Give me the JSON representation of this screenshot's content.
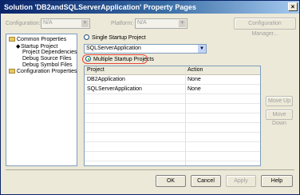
{
  "window": {
    "title": "Solution 'DB2andSQLServerApplication' Property Pages",
    "close_glyph": "×"
  },
  "topbar": {
    "configuration_label": "Configuration:",
    "configuration_value": "N/A",
    "platform_label": "Platform:",
    "platform_value": "N/A",
    "config_manager_label": "Configuration Manager..."
  },
  "tree": {
    "common_properties": "Common Properties",
    "startup_project": "Startup Project",
    "project_dependencies": "Project Dependencies",
    "debug_source_files": "Debug Source Files",
    "debug_symbol_files": "Debug Symbol Files",
    "configuration_properties": "Configuration Properties"
  },
  "content": {
    "single_startup_label": "Single Startup Project",
    "single_startup_value": "SQLServerApplication",
    "multiple_startup_label": "Multiple Startup Projects",
    "grid": {
      "col_project": "Project",
      "col_action": "Action",
      "rows": [
        {
          "project": "DB2Application",
          "action": "None"
        },
        {
          "project": "SQLServerApplication",
          "action": "None"
        }
      ]
    },
    "move_up_label": "Move Up",
    "move_down_label": "Move Down"
  },
  "buttons": {
    "ok": "OK",
    "cancel": "Cancel",
    "apply": "Apply",
    "help": "Help"
  }
}
